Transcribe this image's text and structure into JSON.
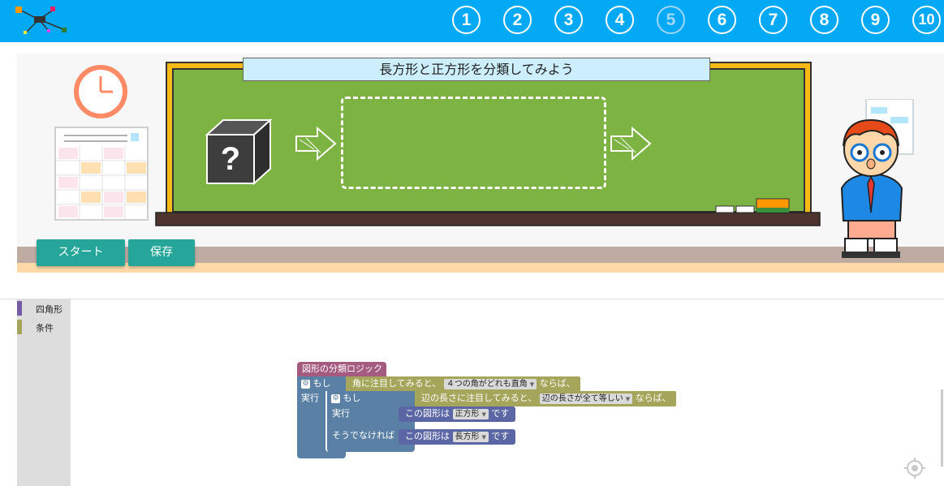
{
  "nav": {
    "steps": [
      "1",
      "2",
      "3",
      "4",
      "5",
      "6",
      "7",
      "8",
      "9",
      "10"
    ],
    "active_step": "5"
  },
  "stage": {
    "board_title": "長方形と正方形を分類してみよう",
    "mystery_glyph": "?",
    "start_label": "スタート",
    "save_label": "保存"
  },
  "toolbox": {
    "categories": [
      {
        "label": "四角形",
        "color": "#745ba5"
      },
      {
        "label": "条件",
        "color": "#a5a55b"
      }
    ]
  },
  "blocks": {
    "procedure_name": "図形の分類ロジック",
    "outer_if": {
      "if_label": "もし",
      "cond_text": "角に注目してみると、",
      "cond_option": "４つの角がどれも直角",
      "cond_suffix": "ならば、",
      "do_label": "実行"
    },
    "inner_if": {
      "if_label": "もし",
      "cond_text": "辺の長さに注目してみると、",
      "cond_option": "辺の長さが全て等しい",
      "cond_suffix": "ならば、",
      "do_label": "実行",
      "else_label": "そうでなければ"
    },
    "result_square": {
      "prefix": "この図形は",
      "option": "正方形",
      "suffix": "です"
    },
    "result_rect": {
      "prefix": "この図形は",
      "option": "長方形",
      "suffix": "です"
    }
  },
  "colors": {
    "topbar": "#03a9f4",
    "accent_button": "#26a69a",
    "board": "#7cb342",
    "logic_block": "#5b80a5",
    "condition_block": "#a5a55b",
    "shape_block": "#5b67a5",
    "procedure_block": "#a55b80"
  }
}
